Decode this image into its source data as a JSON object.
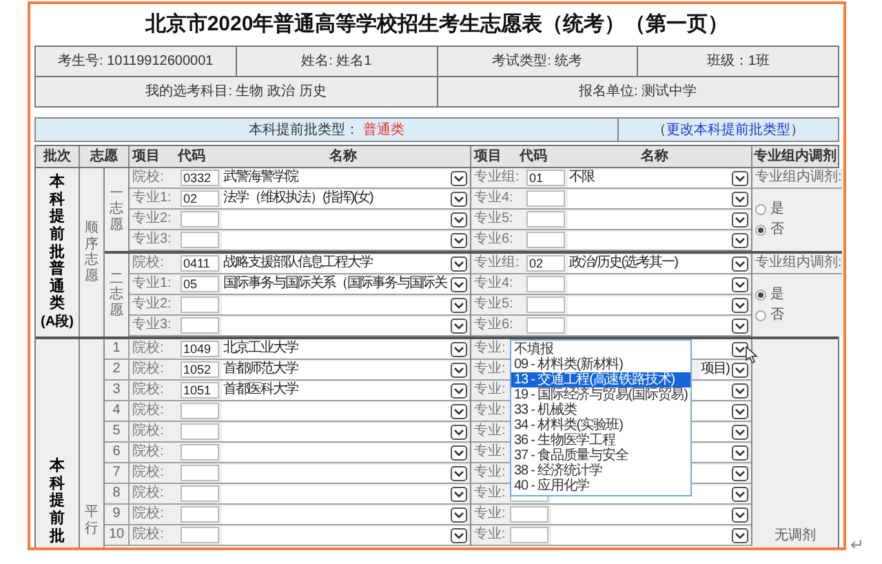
{
  "title": "北京市2020年普通高等学校招生考生志愿表（统考）（第一页）",
  "info_rows": [
    [
      "考生号: 10119912600001",
      "姓名: 姓名1",
      "考试类型: 统考",
      "班级：1班"
    ],
    [
      "我的选考科目: 生物 政治 历史",
      "报名单位: 测试中学"
    ]
  ],
  "batch_type": {
    "label": "本科提前批类型：",
    "value": "普通类",
    "link_open": "（",
    "link": "更改本科提前批类型",
    "link_close": "）"
  },
  "table": {
    "columns": {
      "batch": "批次",
      "choice": "志愿",
      "item": "项目",
      "code": "代码",
      "name": "名称",
      "item_2": "项目",
      "code_2": "代码",
      "name_2": "名称",
      "adjust": "专业组内调剂"
    },
    "sections": [
      {
        "kind": "sequential",
        "batch": "本科提前批普通类",
        "batch_note": "(A段)",
        "mode": "顺序志愿",
        "choices": [
          {
            "label": "一志愿",
            "rows": [
              {
                "item": "院校:",
                "code": "0332",
                "name": "武警海警学院"
              },
              {
                "item": "专业1:",
                "code": "02",
                "name": "法学（维权执法）(指挥)(女)"
              },
              {
                "item": "专业2:"
              },
              {
                "item": "专业3:"
              }
            ],
            "rows_2": [
              {
                "item": "专业组:",
                "code": "01",
                "name": "不限"
              },
              {
                "item": "专业4:"
              },
              {
                "item": "专业5:"
              },
              {
                "item": "专业6:"
              }
            ],
            "adjust": {
              "label": "专业组内调剂:",
              "options": [
                {
                  "label": "是",
                  "selected": false
                },
                {
                  "label": "否",
                  "selected": true
                }
              ]
            }
          },
          {
            "label": "二志愿",
            "rows": [
              {
                "item": "院校:",
                "code": "0411",
                "name": "战略支援部队信息工程大学"
              },
              {
                "item": "专业1:",
                "code": "05",
                "name": "国际事务与国际关系（国际事务与国际关"
              },
              {
                "item": "专业2:"
              },
              {
                "item": "专业3:"
              }
            ],
            "rows_2": [
              {
                "item": "专业组:",
                "code": "02",
                "name": "政治/历史(选考其一)"
              },
              {
                "item": "专业4:"
              },
              {
                "item": "专业5:"
              },
              {
                "item": "专业6:"
              }
            ],
            "adjust": {
              "label": "专业组内调剂:",
              "options": [
                {
                  "label": "是",
                  "selected": true
                },
                {
                  "label": "否",
                  "selected": false
                }
              ]
            }
          }
        ]
      },
      {
        "kind": "parallel",
        "batch": "本科提前批",
        "mode": "平行",
        "adjust_text": "无调剂",
        "rows": [
          {
            "no": "1",
            "item": "院校:",
            "code": "1049",
            "name": "北京工业大学",
            "item_2": "专业:"
          },
          {
            "no": "2",
            "item": "院校:",
            "code": "1052",
            "name": "首都师范大学",
            "item_2": "专业:",
            "name_2": "项目)"
          },
          {
            "no": "3",
            "item": "院校:",
            "code": "1051",
            "name": "首都医科大学",
            "item_2": "专业:"
          },
          {
            "no": "4",
            "item": "院校:",
            "item_2": "专业:"
          },
          {
            "no": "5",
            "item": "院校:",
            "item_2": "专业:"
          },
          {
            "no": "6",
            "item": "院校:",
            "item_2": "专业:"
          },
          {
            "no": "7",
            "item": "院校:",
            "item_2": "专业:"
          },
          {
            "no": "8",
            "item": "院校:",
            "item_2": "专业:"
          },
          {
            "no": "9",
            "item": "院校:",
            "item_2": "专业:"
          },
          {
            "no": "10",
            "item": "院校:",
            "item_2": "专业:"
          }
        ],
        "dropdown": {
          "options": [
            {
              "label": "不填报",
              "selected": false
            },
            {
              "label": "09 - 材料类(新材料)",
              "selected": false
            },
            {
              "label": "13 - 交通工程(高速铁路技术)",
              "selected": true
            },
            {
              "label": "19 - 国际经济与贸易(国际贸易)",
              "selected": false
            },
            {
              "label": "33 - 机械类",
              "selected": false
            },
            {
              "label": "34 - 材料类(实验班)",
              "selected": false
            },
            {
              "label": "36 - 生物医学工程",
              "selected": false
            },
            {
              "label": "37 - 食品质量与安全",
              "selected": false
            },
            {
              "label": "38 - 经济统计学",
              "selected": false
            },
            {
              "label": "40 - 应用化学",
              "selected": false
            }
          ]
        }
      }
    ]
  },
  "return_mark": "↵"
}
